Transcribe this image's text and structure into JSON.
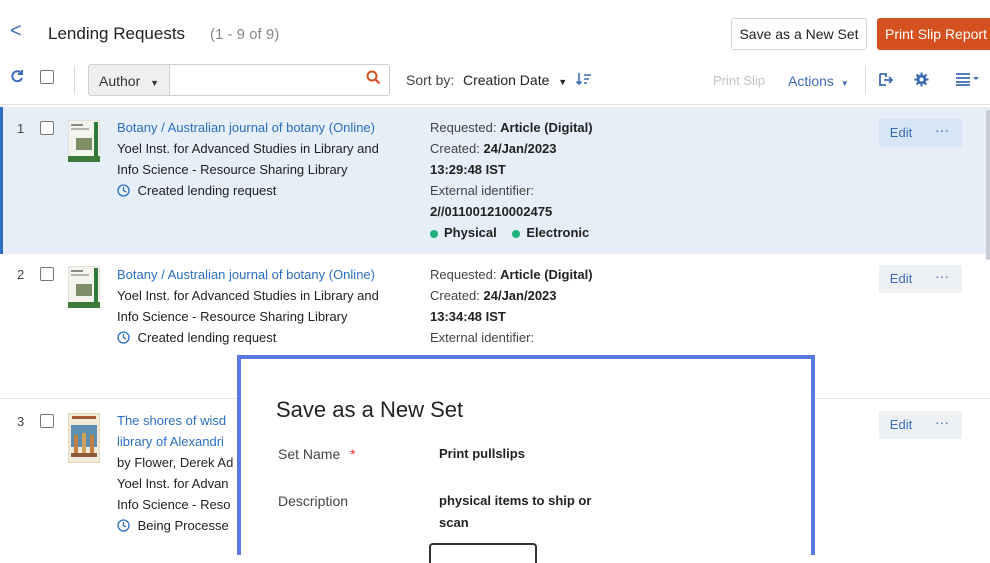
{
  "header": {
    "back_glyph": "<",
    "title": "Lending Requests",
    "count": "(1 - 9 of 9)",
    "save_set_label": "Save as a New Set",
    "print_report_label": "Print Slip Report"
  },
  "toolbar": {
    "search_field": "Author",
    "search_placeholder": "",
    "sort_by_label": "Sort by:",
    "sort_value": "Creation Date",
    "print_slip_label": "Print Slip",
    "actions_label": "Actions"
  },
  "rows": [
    {
      "num": "1",
      "title": "Botany / Australian journal of botany (Online)",
      "line1": "Yoel Inst. for Advanced Studies in Library and",
      "line2": "Info Science - Resource Sharing Library",
      "status": "Created lending request",
      "requested_label": "Requested:",
      "requested_value": "Article (Digital)",
      "created_label": "Created:",
      "created_value": "24/Jan/2023",
      "created_time": "13:29:48 IST",
      "ext_label": "External identifier:",
      "ext_value": "2//011001210002475",
      "tag1": "Physical",
      "tag2": "Electronic",
      "edit": "Edit",
      "more": "···"
    },
    {
      "num": "2",
      "title": "Botany / Australian journal of botany (Online)",
      "line1": "Yoel Inst. for Advanced Studies in Library and",
      "line2": "Info Science - Resource Sharing Library",
      "status": "Created lending request",
      "requested_label": "Requested:",
      "requested_value": "Article (Digital)",
      "created_label": "Created:",
      "created_value": "24/Jan/2023",
      "created_time": "13:34:48 IST",
      "ext_label": "External identifier:",
      "edit": "Edit",
      "more": "···"
    },
    {
      "num": "3",
      "title_a": "The shores of wisd",
      "title_b": "library of Alexandri",
      "line1": "by Flower, Derek Ad",
      "line2": "Yoel Inst. for Advan",
      "line3": "Info Science - Reso",
      "status": "Being Processe",
      "edit": "Edit",
      "more": "···"
    }
  ],
  "modal": {
    "title": "Save as a New Set",
    "set_name_label": "Set Name",
    "required_mark": "*",
    "set_name_value": "Print pullslips",
    "description_label": "Description",
    "description_line1": "physical items to ship or",
    "description_line2": "scan"
  },
  "colors": {
    "accent": "#2b6fc3",
    "primary_button": "#d5501f",
    "selected_row": "#e6eef7",
    "modal_border": "#5a79e0",
    "status_dot": "#22b07d"
  }
}
